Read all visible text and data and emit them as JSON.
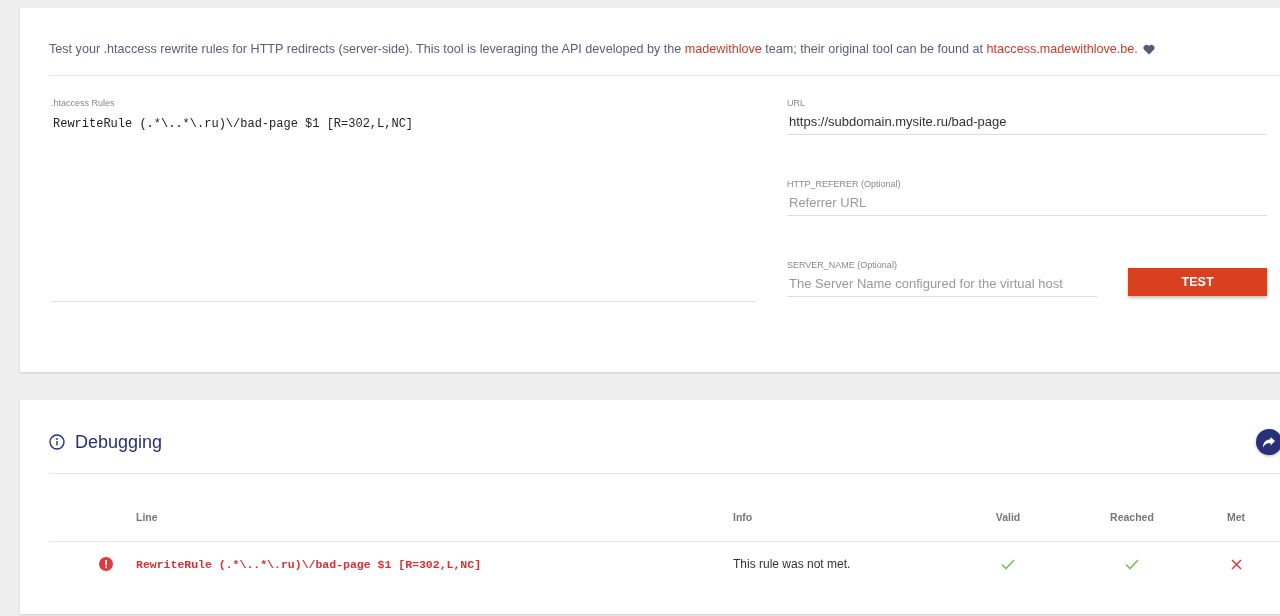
{
  "intro": {
    "parts": [
      {
        "kind": "text",
        "text": "Test your .htaccess rewrite rules for HTTP redirects (server-side). This tool is leveraging the API developed by the "
      },
      {
        "kind": "link",
        "text": "madewithlove"
      },
      {
        "kind": "text",
        "text": " team; their original tool can be found at "
      },
      {
        "kind": "link",
        "text": "htaccess.madewithlove.be"
      },
      {
        "kind": "text",
        "text": "."
      }
    ]
  },
  "rules": {
    "label": ".htaccess Rules",
    "value": "RewriteRule (.*\\..*\\.ru)\\/bad-page $1 [R=302,L,NC]"
  },
  "url": {
    "label": "URL",
    "value": "https://subdomain.mysite.ru/bad-page"
  },
  "referer": {
    "label": "HTTP_REFERER (Optional)",
    "placeholder": "Referrer URL"
  },
  "server_name": {
    "label": "SERVER_NAME (Optional)",
    "placeholder": "The Server Name configured for the virtual host"
  },
  "test_button": "TEST",
  "debugging": {
    "title": "Debugging",
    "columns": [
      "Line",
      "Info",
      "Valid",
      "Reached",
      "Met"
    ],
    "rows": [
      {
        "line": "RewriteRule (.*\\..*\\.ru)\\/bad-page $1 [R=302,L,NC]",
        "info": "This rule was not met.",
        "valid": true,
        "reached": true,
        "met": false
      }
    ]
  }
}
